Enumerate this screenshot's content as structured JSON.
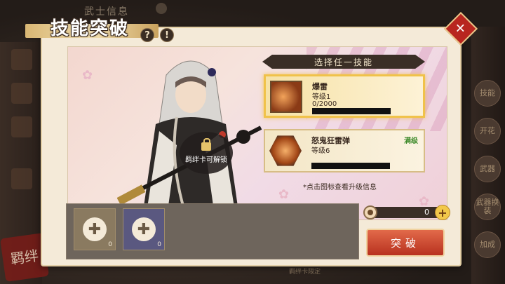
{
  "background": {
    "header_text": "武士信息",
    "seal_text": "羁绊",
    "bottom_label": "羁绊卡限定",
    "side_tabs": [
      "技能",
      "开花",
      "武器",
      "武器换装",
      "加成"
    ]
  },
  "title": {
    "text": "技能突破",
    "help_symbol": "?",
    "warn_symbol": "!"
  },
  "close": {
    "symbol": "✕"
  },
  "character": {
    "lock_label": "羁绊卡可解锁"
  },
  "skills": {
    "header": "选择任一技能",
    "items": [
      {
        "name": "爆雷",
        "level": "等级1",
        "progress": "0/2000",
        "selected": true
      },
      {
        "name": "怒鬼狂雷弹",
        "level": "等级6",
        "max_label": "满级",
        "selected": false
      }
    ],
    "hint": "*点击图标查看升级信息"
  },
  "materials": {
    "slots": [
      {
        "count": "0",
        "color": "#8a7a60"
      },
      {
        "count": "0",
        "color": "#5a5880"
      }
    ]
  },
  "controls": {
    "counter_value": "0",
    "plus_symbol": "+",
    "break_label": "突破"
  },
  "colors": {
    "accent_red": "#b8311f",
    "gold": "#f0c24a",
    "panel": "#f4ead8"
  }
}
